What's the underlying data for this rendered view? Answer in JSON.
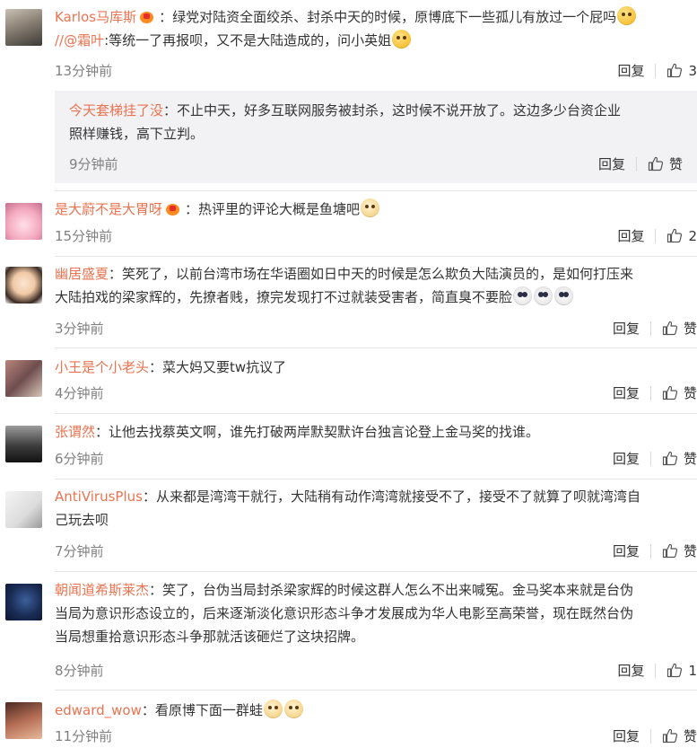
{
  "labels": {
    "reply": "回复",
    "like": "赞"
  },
  "comments": [
    {
      "user": "Karlos马库斯",
      "text": "绿党对陆资全面绞杀、封杀中天的时候，原博底下一些孤儿有放过一个屁吗",
      "mention": "//@霜叶",
      "mention_text": ":等统一了再报呗，又不是大陆造成的，问小英姐",
      "time": "13分钟前",
      "likes": "3",
      "reply": {
        "user": "今天套梯挂了没",
        "text": "不止中天，好多互联网服务被封杀，这时候不说开放了。这边多少台资企业",
        "text2": "照样赚钱，高下立判。",
        "time": "9分钟前"
      }
    },
    {
      "user": "是大蔚不是大胃呀",
      "text": "热评里的评论大概是鱼塘吧",
      "time": "15分钟前",
      "likes": "2"
    },
    {
      "user": "幽居盛夏",
      "text": "笑死了，以前台湾市场在华语圈如日中天的时候是怎么欺负大陆演员的，是如何打压来",
      "text2": "大陆拍戏的梁家辉的，先撩者贱，撩完发现打不过就装受害者，简直臭不要脸",
      "time": "3分钟前"
    },
    {
      "user": "小王是个小老头",
      "text": "菜大妈又要tw抗议了",
      "time": "4分钟前"
    },
    {
      "user": "张谓然",
      "text": "让他去找蔡英文啊，谁先打破两岸默契默许台独言论登上金马奖的找谁。",
      "time": "6分钟前"
    },
    {
      "user": "AntiVirusPlus",
      "text": "从来都是湾湾干就行，大陆稍有动作湾湾就接受不了，接受不了就算了呗就湾湾自",
      "text2": "己玩去呗",
      "time": "7分钟前"
    },
    {
      "user": "朝闻道希斯莱杰",
      "text": "笑了，台伪当局封杀梁家辉的时候这群人怎么不出来喊冤。金马奖本来就是台伪",
      "text2": "当局为意识形态设立的，后来逐渐淡化意识形态斗争才发展成为华人电影至高荣誉，现在既然台伪",
      "text3": "当局想重拾意识形态斗争那就活该砸烂了这块招牌。",
      "time": "8分钟前",
      "likes": "1"
    },
    {
      "user": "edward_wow",
      "text": "看原博下面一群蛙",
      "time": "11分钟前"
    }
  ]
}
